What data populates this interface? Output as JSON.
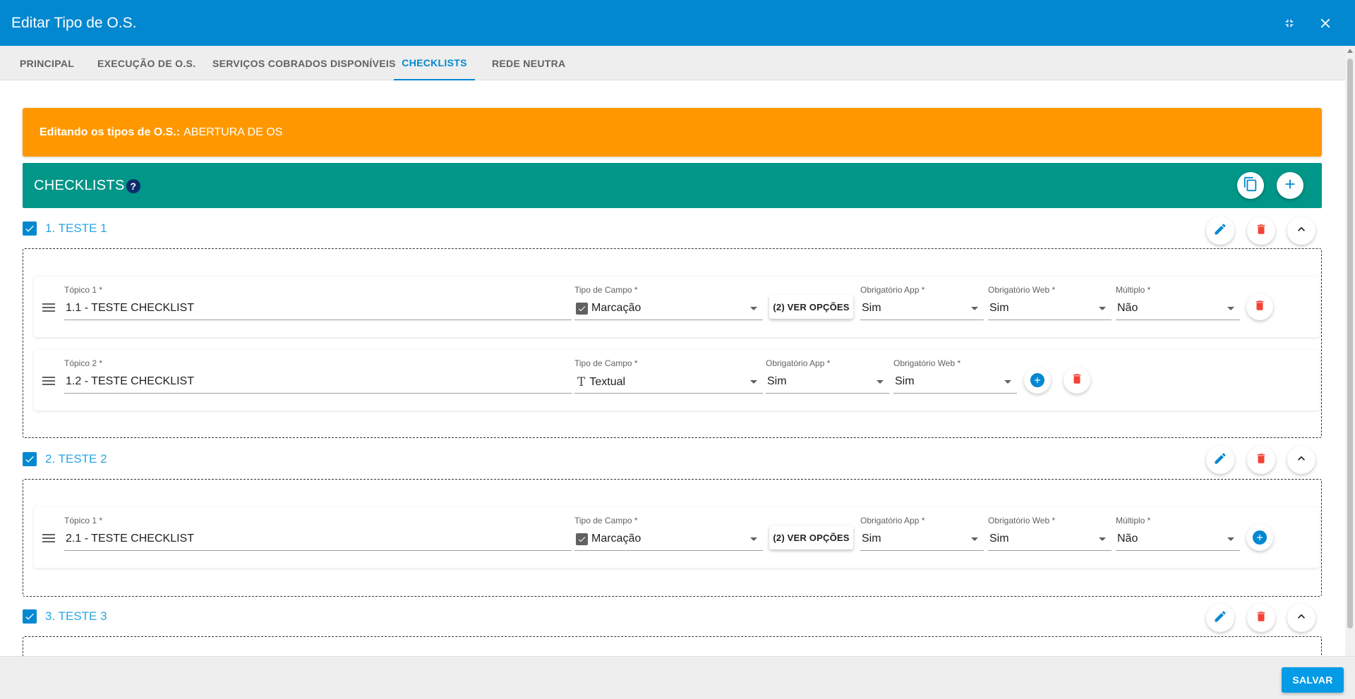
{
  "dialog": {
    "title": "Editar Tipo de O.S.",
    "minimize_icon": "fullscreen-exit-icon",
    "close_icon": "close-icon"
  },
  "tabs": [
    {
      "label": "PRINCIPAL",
      "active": false
    },
    {
      "label": "EXECUÇÃO DE O.S.",
      "active": false
    },
    {
      "label": "SERVIÇOS COBRADOS DISPONÍVEIS",
      "active": false
    },
    {
      "label": "CHECKLISTS",
      "active": true
    },
    {
      "label": "REDE NEUTRA",
      "active": false
    }
  ],
  "alert": {
    "prefix": "Editando os tipos de O.S.:",
    "value": "ABERTURA DE OS",
    "color": "#ff9800"
  },
  "checklists_header": {
    "label": "CHECKLISTS",
    "help": "?",
    "color": "#009688"
  },
  "groups": [
    {
      "title": "1. TESTE 1",
      "topics": [
        {
          "label": "Tópico 1 *",
          "value": "1.1 - TESTE CHECKLIST",
          "tipo_label": "Tipo de Campo *",
          "tipo_value": "Marcação",
          "options_button": "(2) VER OPÇÕES",
          "app_label": "Obrigatório App *",
          "app_value": "Sim",
          "web_label": "Obrigatório Web *",
          "web_value": "Sim",
          "multiplo_label": "Múltiplo *",
          "multiplo_value": "Não"
        },
        {
          "label": "Tópico 2 *",
          "value": "1.2 - TESTE CHECKLIST",
          "tipo_label": "Tipo de Campo *",
          "tipo_value": "Textual",
          "app_label": "Obrigatório App *",
          "app_value": "Sim",
          "web_label": "Obrigatório Web *",
          "web_value": "Sim"
        }
      ]
    },
    {
      "title": "2. TESTE 2",
      "topics": [
        {
          "label": "Tópico 1 *",
          "value": "2.1 - TESTE CHECKLIST",
          "tipo_label": "Tipo de Campo *",
          "tipo_value": "Marcação",
          "options_button": "(2) VER OPÇÕES",
          "app_label": "Obrigatório App *",
          "app_value": "Sim",
          "web_label": "Obrigatório Web *",
          "web_value": "Sim",
          "multiplo_label": "Múltiplo *",
          "multiplo_value": "Não"
        }
      ]
    },
    {
      "title": "3. TESTE 3",
      "topics": []
    }
  ],
  "footer": {
    "save_label": "SALVAR"
  },
  "colors": {
    "primary": "#0288d1",
    "danger": "#f44336",
    "edit": "#0288d1"
  }
}
